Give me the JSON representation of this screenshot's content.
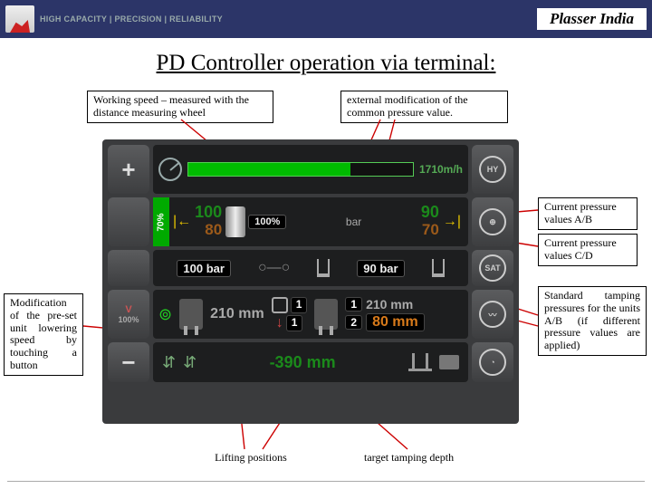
{
  "header": {
    "tagline": "HIGH CAPACITY | PRECISION | RELIABILITY",
    "brand": "Plasser India"
  },
  "title": "PD Controller operation via terminal:",
  "callouts": {
    "working_speed": "Working speed – measured with the distance measuring wheel",
    "external_mod": "external modification of the common pressure value.",
    "pressure_ab": "Current pressure values A/B",
    "pressure_cd": "Current pressure values C/D",
    "std_tamp": "Standard tamping pressures for the units A/B (if different pressure values are applied)",
    "mod_preset": "Modification of the pre-set unit lowering speed by touching a button",
    "lifting": "Lifting positions",
    "target_depth": "target tamping depth"
  },
  "screen": {
    "speed": "1710m/h",
    "pct_vertical": "70%",
    "fill_pct": "100%",
    "press_a": "100",
    "press_b": "80",
    "press_c": "90",
    "press_d": "70",
    "bar_unit": "bar",
    "bar_left": "100 bar",
    "bar_right": "90 bar",
    "lowering_pct": "100%",
    "mm1": "210 mm",
    "mm2": "210 mm",
    "mm3": "80 mm",
    "n1": "1",
    "n1b": "1",
    "n2": "2",
    "depth": "-390 mm",
    "ring_hy": "HY",
    "ring_sat": "SAT"
  }
}
